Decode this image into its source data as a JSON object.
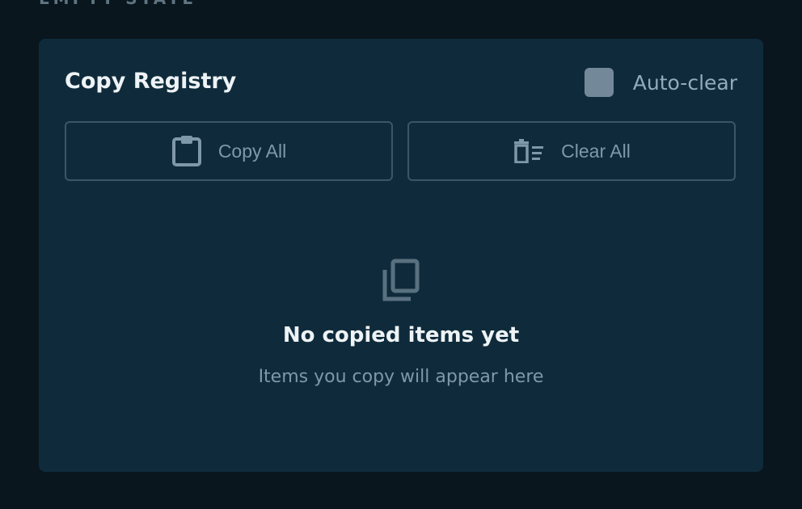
{
  "section_label": "EMPTY STATE",
  "card": {
    "title": "Copy Registry",
    "autoclear_label": "Auto-clear",
    "copy_all_label": "Copy All",
    "clear_all_label": "Clear All",
    "empty_title": "No copied items yet",
    "empty_subtitle": "Items you copy will appear here"
  },
  "icons": {
    "copy_all": "clipboard-icon",
    "clear_all": "trash-list-icon",
    "empty": "copy-stack-icon"
  },
  "colors": {
    "page_bg": "#09161e",
    "card_bg": "#0f2b3b",
    "muted_text": "#7f98a8",
    "checkbox": "#73899a"
  }
}
